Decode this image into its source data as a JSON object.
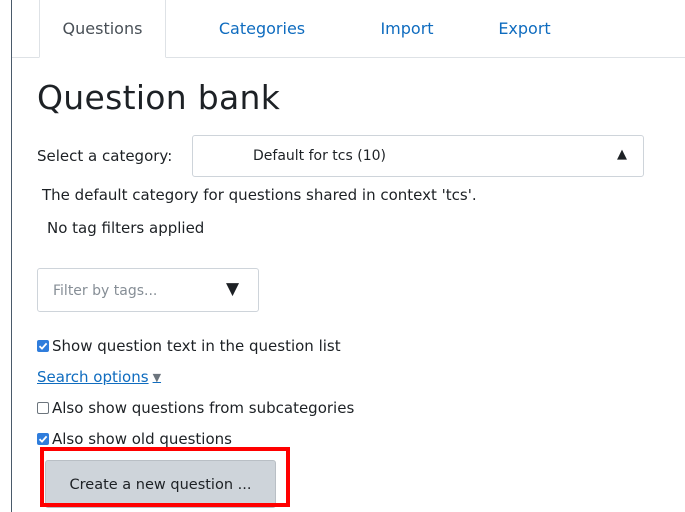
{
  "tabs": [
    {
      "label": "Questions",
      "active": true
    },
    {
      "label": "Categories",
      "active": false
    },
    {
      "label": "Import",
      "active": false
    },
    {
      "label": "Export",
      "active": false
    }
  ],
  "page_title": "Question bank",
  "category": {
    "label": "Select a category:",
    "selected": "Default for tcs (10)",
    "description": "The default category for questions shared in context 'tcs'."
  },
  "tag_status": "No tag filters applied",
  "tag_filter": {
    "placeholder": "Filter by tags..."
  },
  "options": {
    "show_text": {
      "label": "Show question text in the question list",
      "checked": true
    },
    "search_options": "Search options",
    "subcategories": {
      "label": "Also show questions from subcategories",
      "checked": false
    },
    "old_questions": {
      "label": "Also show old questions",
      "checked": true
    }
  },
  "create_button": "Create a new question ...",
  "colors": {
    "accent": "#0f6cbf",
    "checkbox": "#2f7ddc",
    "highlight": "#ff0000"
  }
}
